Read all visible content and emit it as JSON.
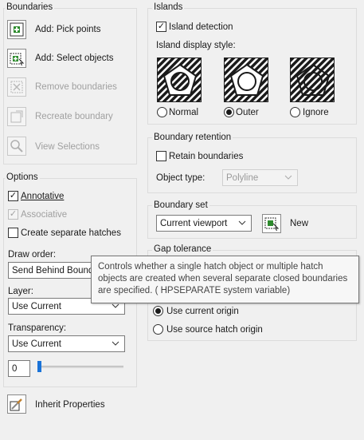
{
  "boundaries": {
    "title": "Boundaries",
    "add_pick_points": "Add: Pick points",
    "add_select_objects": "Add: Select objects",
    "remove_boundaries": "Remove boundaries",
    "recreate_boundary": "Recreate boundary",
    "view_selections": "View Selections"
  },
  "options": {
    "title": "Options",
    "annotative": "Annotative",
    "associative": "Associative",
    "create_separate_hatches": "Create separate hatches",
    "draw_order_label": "Draw order:",
    "draw_order_value": "Send Behind Bounda",
    "layer_label": "Layer:",
    "layer_value": "Use Current",
    "transparency_label": "Transparency:",
    "transparency_value": "Use Current",
    "transparency_number": "0",
    "transparency_level": 0
  },
  "inherit": {
    "label": "Inherit Properties"
  },
  "islands": {
    "title": "Islands",
    "island_detection": "Island detection",
    "display_style_label": "Island display style:",
    "normal": "Normal",
    "outer": "Outer",
    "ignore": "Ignore"
  },
  "retention": {
    "title": "Boundary retention",
    "retain_boundaries": "Retain boundaries",
    "object_type_label": "Object type:",
    "object_type_value": "Polyline"
  },
  "boundary_set": {
    "title": "Boundary set",
    "value": "Current viewport",
    "new_label": "New"
  },
  "gap": {
    "title": "Gap tolerance"
  },
  "origin": {
    "use_current_origin": "Use current origin",
    "use_source_origin": "Use source hatch origin"
  },
  "tooltip": {
    "text": "Controls whether a single hatch object or multiple hatch objects are created when several separate closed boundaries are specified. ( HPSEPARATE system variable)"
  }
}
